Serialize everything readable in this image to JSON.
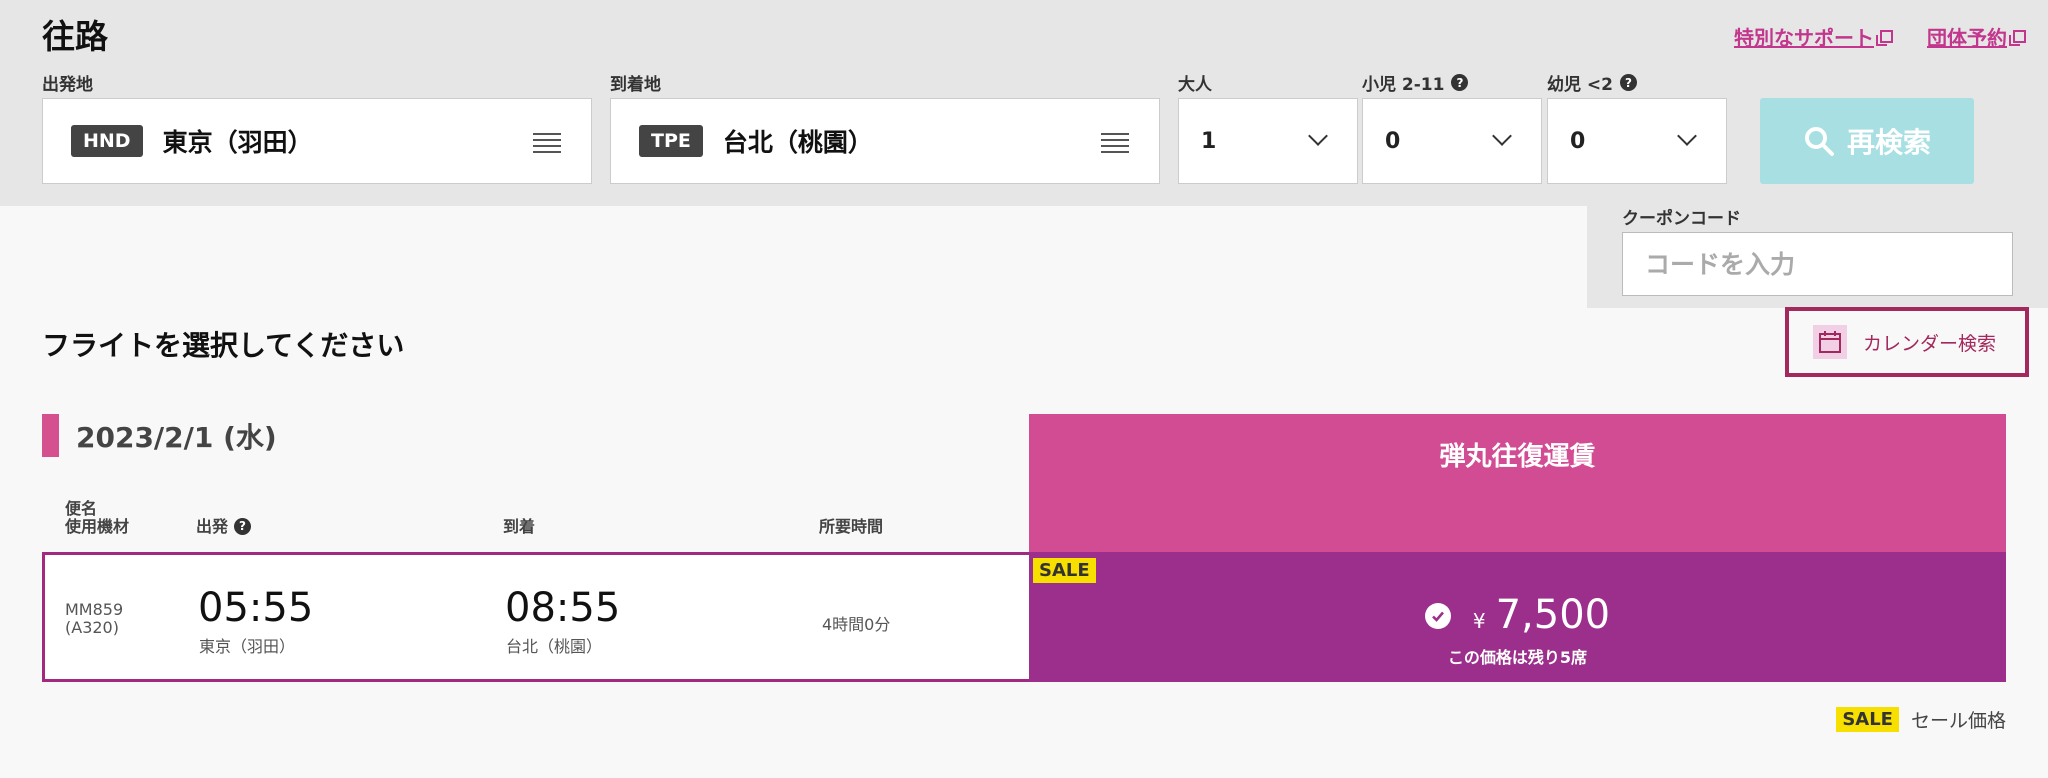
{
  "header": {
    "title": "往路",
    "links": [
      {
        "label": "特別なサポート"
      },
      {
        "label": "団体予約"
      }
    ]
  },
  "search": {
    "origin": {
      "label": "出発地",
      "code": "HND",
      "city": "東京（羽田）"
    },
    "destination": {
      "label": "到着地",
      "code": "TPE",
      "city": "台北（桃園）"
    },
    "adults": {
      "label": "大人",
      "value": "1"
    },
    "children": {
      "label": "小児 2-11",
      "value": "0"
    },
    "infants": {
      "label": "幼児 <2",
      "value": "0"
    },
    "search_button": "再検索",
    "coupon": {
      "label": "クーポンコード",
      "placeholder": "コードを入力"
    }
  },
  "results": {
    "title": "フライトを選択してください",
    "calendar_button": "カレンダー検索",
    "date": "2023/2/1 (水)",
    "fare_header": "弾丸往復運賃",
    "columns": {
      "flight_line1": "便名",
      "flight_line2": "使用機材",
      "departure": "出発",
      "arrival": "到着",
      "duration": "所要時間"
    },
    "flights": [
      {
        "flight_no": "MM859",
        "aircraft": "(A320)",
        "dep_time": "05:55",
        "dep_place": "東京（羽田）",
        "arr_time": "08:55",
        "arr_place": "台北（桃園）",
        "duration": "4時間0分",
        "sale_badge": "SALE",
        "currency": "¥",
        "price": "7,500",
        "seats_note": "この価格は残り5席"
      }
    ],
    "legend": {
      "badge": "SALE",
      "text": "セール価格"
    }
  },
  "colors": {
    "brand_pink": "#d24c93",
    "brand_purple": "#9c2f8c",
    "link": "#c2378d",
    "search_button": "#a7dfe3",
    "sale_yellow": "#f7e000"
  }
}
